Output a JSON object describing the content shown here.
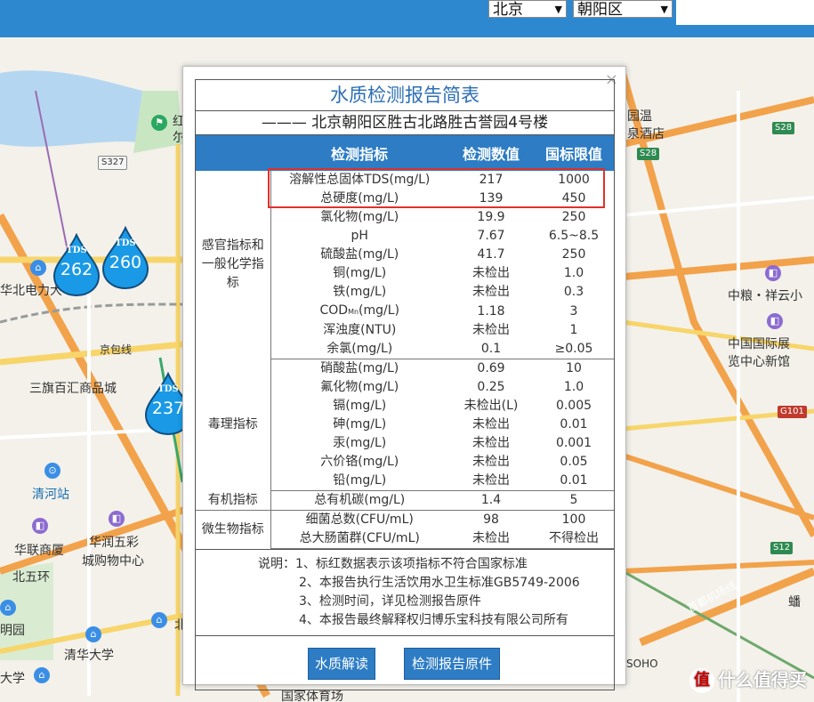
{
  "topbar": {
    "city": "北京",
    "district": "朝阳区",
    "search_value": ""
  },
  "map": {
    "labels": {
      "huabei": "华北电力大",
      "jingbao": "京包线",
      "sanqi": "三旗百汇商品城",
      "qinghe": "清河站",
      "hualian": "华联商厦",
      "huarun1": "华润五彩",
      "huarun2": "城购物中心",
      "beiwuhuan": "北五环",
      "mingyuan": "明园",
      "qinghua": "清华大学",
      "daxue": "大学",
      "tiyuchang": "国家体育场",
      "zhongliang": "中粮・祥云小",
      "expo1": "中国国际展",
      "expo2": "览中心新馆",
      "yuanwen": "园温",
      "jiudian": "泉酒店",
      "pan": "蟠",
      "soho": "SOHO",
      "hong": "红",
      "er": "尔",
      "bei": "北",
      "airport": "首都机场线"
    },
    "shields": {
      "s327": "S327",
      "s28a": "S28",
      "s28b": "S28",
      "g101": "G101",
      "s12": "S12"
    },
    "pins": [
      {
        "label": "TDS",
        "value": "262"
      },
      {
        "label": "TDS",
        "value": "260"
      },
      {
        "label": "TDS",
        "value": "237"
      }
    ],
    "watermark": "什么值得买",
    "watermark_badge": "值"
  },
  "modal": {
    "close": "×",
    "title": "水质检测报告简表",
    "subtitle": "——— 北京朝阳区胜古北路胜古誉园4号楼",
    "headers": [
      "检测指标",
      "检测数值",
      "国标限值"
    ],
    "groups": [
      {
        "category": "感官指标和一般化学指标",
        "rows": [
          {
            "name": "溶解性总固体TDS(mg/L)",
            "value": "217",
            "limit": "1000"
          },
          {
            "name": "总硬度(mg/L)",
            "value": "139",
            "limit": "450"
          },
          {
            "name": "氯化物(mg/L)",
            "value": "19.9",
            "limit": "250"
          },
          {
            "name": "pH",
            "value": "7.67",
            "limit": "6.5~8.5"
          },
          {
            "name": "硫酸盐(mg/L)",
            "value": "41.7",
            "limit": "250"
          },
          {
            "name": "铜(mg/L)",
            "value": "未检出",
            "limit": "1.0"
          },
          {
            "name": "铁(mg/L)",
            "value": "未检出",
            "limit": "0.3"
          },
          {
            "name": "COD",
            "name_sub": "Mn",
            "name_tail": "(mg/L)",
            "value": "1.18",
            "limit": "3"
          },
          {
            "name": "浑浊度(NTU)",
            "value": "未检出",
            "limit": "1"
          },
          {
            "name": "余氯(mg/L)",
            "value": "0.1",
            "limit": "≥0.05"
          }
        ]
      },
      {
        "category": "毒理指标",
        "rows": [
          {
            "name": "硝酸盐(mg/L)",
            "value": "0.69",
            "limit": "10"
          },
          {
            "name": "氟化物(mg/L)",
            "value": "0.25",
            "limit": "1.0"
          },
          {
            "name": "镉(mg/L)",
            "value": "未检出(L)",
            "limit": "0.005"
          },
          {
            "name": "砷(mg/L)",
            "value": "未检出",
            "limit": "0.01"
          },
          {
            "name": "汞(mg/L)",
            "value": "未检出",
            "limit": "0.001"
          },
          {
            "name": "六价铬(mg/L)",
            "value": "未检出",
            "limit": "0.05"
          },
          {
            "name": "铅(mg/L)",
            "value": "未检出",
            "limit": "0.01"
          }
        ]
      },
      {
        "category": "有机指标",
        "rows": [
          {
            "name": "总有机碳(mg/L)",
            "value": "1.4",
            "limit": "5"
          }
        ]
      },
      {
        "category": "微生物指标",
        "rows": [
          {
            "name": "细菌总数(CFU/mL)",
            "value": "98",
            "limit": "100"
          },
          {
            "name": "总大肠菌群(CFU/mL)",
            "value": "未检出",
            "limit": "不得检出"
          }
        ]
      }
    ],
    "notes": [
      "说明：1、标红数据表示该项指标不符合国家标准",
      "2、本报告执行生活饮用水卫生标准GB5749-2006",
      "3、检测时间，详见检测报告原件",
      "4、本报告最终解释权归博乐宝科技有限公司所有"
    ],
    "buttons": {
      "interpret": "水质解读",
      "original": "检测报告原件"
    }
  },
  "colors": {
    "topbar": "#2e88d0",
    "header": "#2d7cc4",
    "title": "#2d6fb3",
    "pin": "#1a9ae6",
    "highlight": "#e0302b"
  }
}
